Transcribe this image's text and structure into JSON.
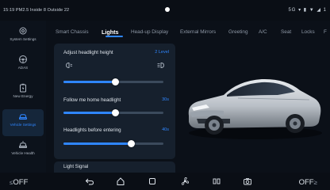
{
  "status_bar": {
    "left_text": "15:19 PM2.5 Inside 8 Outside 22",
    "right_text": "5G ▾ ▮ ▼ ◢ 1"
  },
  "sidebar": {
    "items": [
      {
        "label": "System Settings",
        "icon": "gear-icon",
        "active": false
      },
      {
        "label": "ADAS",
        "icon": "steering-wheel-icon",
        "active": false
      },
      {
        "label": "New Energy",
        "icon": "battery-icon",
        "active": false
      },
      {
        "label": "Vehicle Settings",
        "icon": "car-icon",
        "active": true
      },
      {
        "label": "Vehicle Health",
        "icon": "car-health-icon",
        "active": false
      }
    ]
  },
  "tabs": {
    "items": [
      {
        "label": "Smart Chassis",
        "active": false
      },
      {
        "label": "Lights",
        "active": true
      },
      {
        "label": "Head-up Display",
        "active": false
      },
      {
        "label": "External Mirrors",
        "active": false
      },
      {
        "label": "Greeting",
        "active": false
      },
      {
        "label": "A/C",
        "active": false
      },
      {
        "label": "Seat",
        "active": false
      },
      {
        "label": "Locks",
        "active": false
      },
      {
        "label": "F",
        "active": false
      }
    ]
  },
  "lights_panel": {
    "headlight_height": {
      "label": "Adjust headlight height",
      "value": "2 Level",
      "fraction": 0.52
    },
    "follow_me_home": {
      "label": "Follow me home headlight",
      "value": "30s",
      "fraction": 0.52
    },
    "before_entering": {
      "label": "Headlights before entering",
      "value": "40s",
      "fraction": 0.68
    },
    "light_signal_label": "Light Signal"
  },
  "bottom_bar": {
    "left_off": "OFF",
    "right_off": "OFF",
    "nav_icons": [
      "back-icon",
      "home-icon",
      "recent-apps-icon",
      "fan-icon",
      "media-icon",
      "camera-icon"
    ]
  },
  "colors": {
    "accent": "#2f86ff",
    "background": "#0b1018",
    "panel": "#16202d"
  }
}
